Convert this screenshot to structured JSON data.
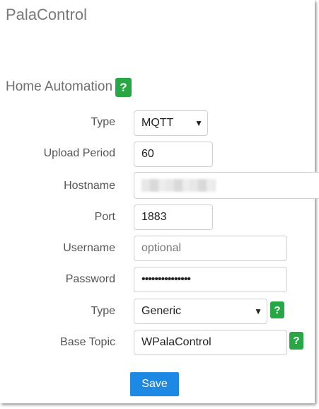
{
  "app_title": "PalaControl",
  "section": {
    "title": "Home Automation",
    "help_label": "?"
  },
  "form": {
    "type_label": "Type",
    "type_value": "MQTT",
    "upload_period_label": "Upload Period",
    "upload_period_value": "60",
    "hostname_label": "Hostname",
    "hostname_value": "",
    "port_label": "Port",
    "port_value": "1883",
    "username_label": "Username",
    "username_placeholder": "optional",
    "password_label": "Password",
    "password_value": "•••••••••••••••",
    "mqtt_type_label": "Type",
    "mqtt_type_value": "Generic",
    "mqtt_type_help": "?",
    "base_topic_label": "Base Topic",
    "base_topic_value": "WPalaControl",
    "base_topic_help": "?"
  },
  "save_label": "Save",
  "colors": {
    "help_green": "#28a745",
    "save_blue": "#1e88e5"
  }
}
